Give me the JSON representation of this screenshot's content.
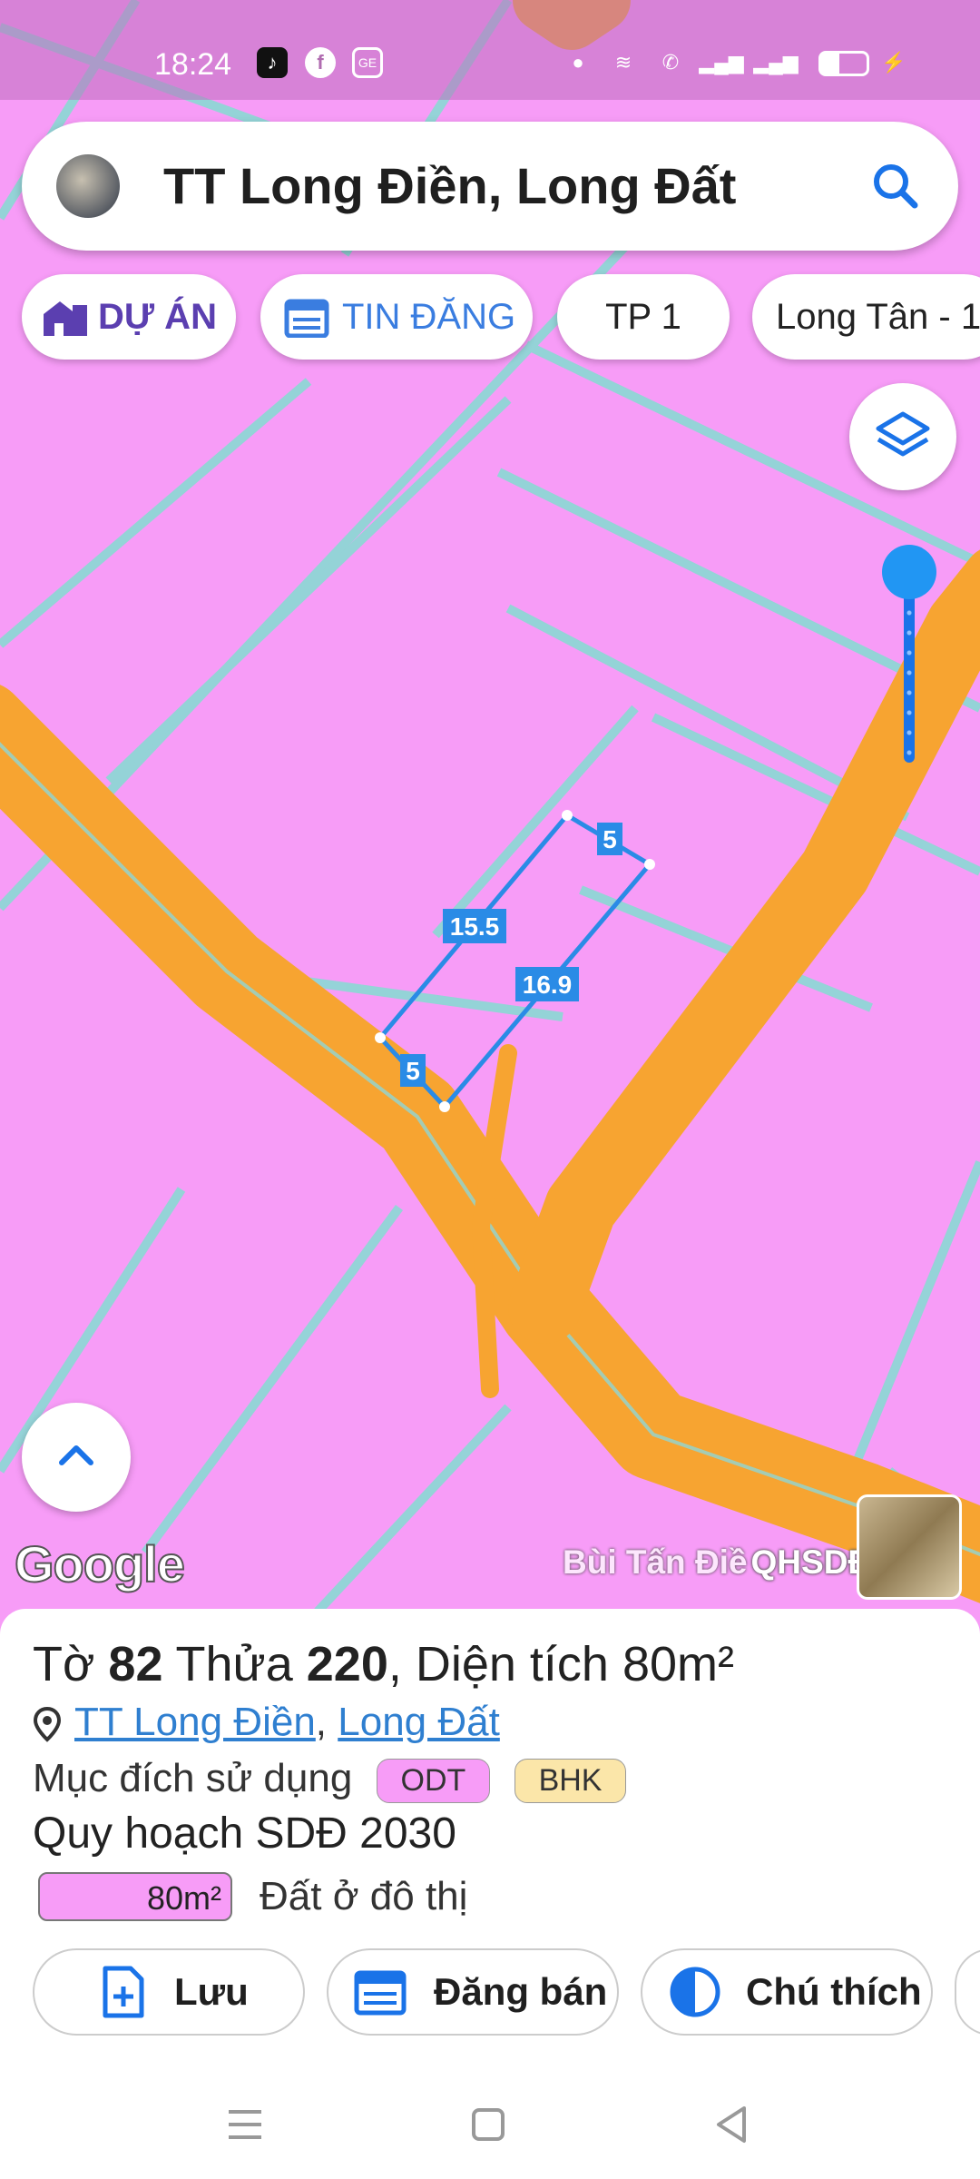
{
  "status": {
    "time": "18:24"
  },
  "search": {
    "query": "TT Long Điền, Long Đất"
  },
  "chips": [
    {
      "label": "DỰ ÁN",
      "color": "#5b3fb0",
      "icon": "building-icon"
    },
    {
      "label": "TIN ĐĂNG",
      "color": "#3a7de0",
      "icon": "calendar-icon"
    },
    {
      "label": "TP 1",
      "color": "#222222",
      "icon": ""
    },
    {
      "label": "Long Tân - 1",
      "color": "#222222",
      "icon": ""
    }
  ],
  "map": {
    "colors": {
      "land": "#f79cf7",
      "road": "#f7a431",
      "boundary": "#8fd6d6",
      "parcel": "#2a8be6"
    },
    "edges": {
      "top": "5",
      "left": "15.5",
      "right": "16.9",
      "bottom": "5"
    },
    "google_label": "Google",
    "attribution_street": "Bùi Tấn Điề",
    "attribution_layer": "QHSDĐ 2030"
  },
  "parcel": {
    "sheet_label": "Tờ",
    "sheet_number": "82",
    "lot_label": "Thửa",
    "lot_number": "220",
    "area_label": ", Diện tích",
    "area_value": "80m²",
    "address_part1": "TT Long Điền",
    "address_separator": ", ",
    "address_part2": "Long Đất",
    "purpose_label": "Mục đích sử dụng",
    "badges": [
      {
        "text": "ODT",
        "bg": "#f79cf7"
      },
      {
        "text": "BHK",
        "bg": "#fbe6a9"
      }
    ],
    "plan_title": "Quy hoạch SDĐ 2030",
    "legend_value": "80m²",
    "legend_label": "Đất ở đô thị"
  },
  "actions": [
    {
      "label": "Lưu",
      "icon": "file-add-icon"
    },
    {
      "label": "Đăng bán",
      "icon": "calendar-icon"
    },
    {
      "label": "Chú thích",
      "icon": "contrast-icon"
    }
  ]
}
